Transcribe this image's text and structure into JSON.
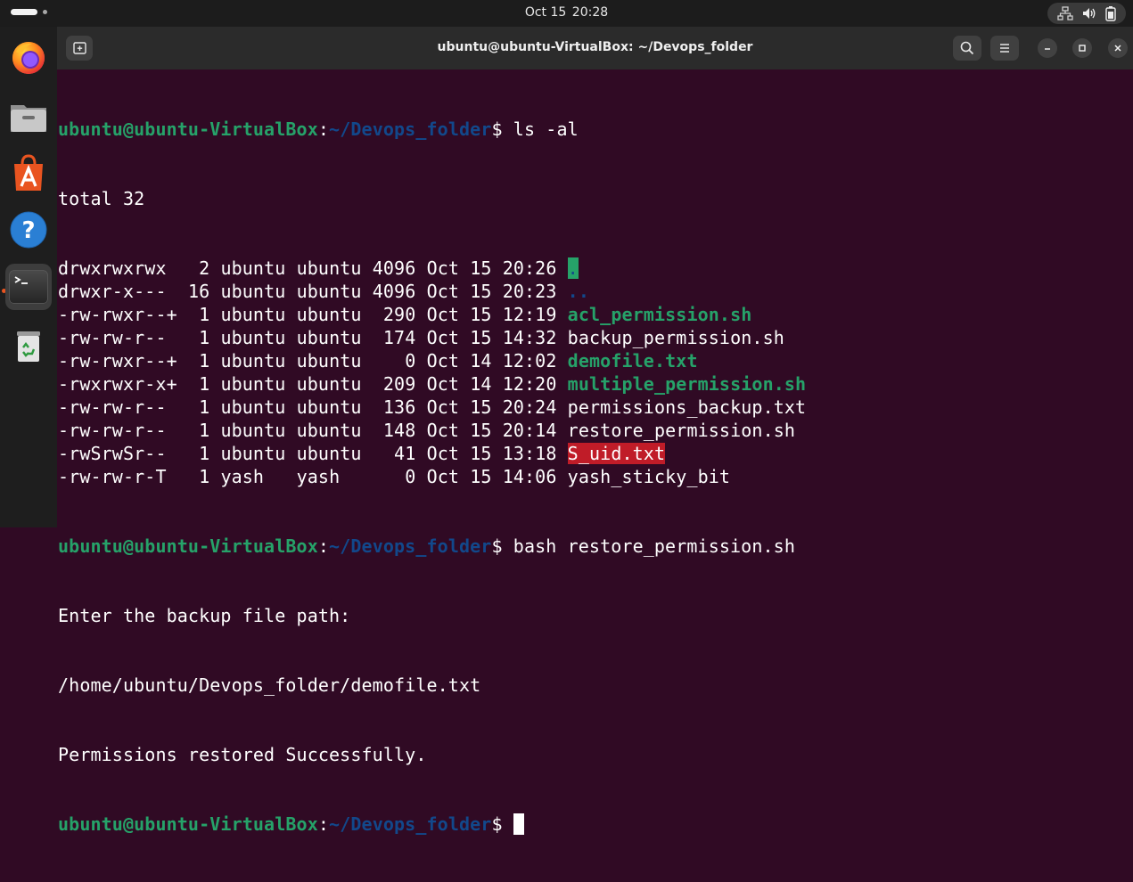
{
  "topbar": {
    "date": "Oct 15",
    "time": "20:28",
    "tray_icons": [
      "network-icon",
      "volume-icon",
      "battery-icon"
    ]
  },
  "dock": {
    "apps": [
      {
        "name": "firefox-icon",
        "label": "Firefox"
      },
      {
        "name": "files-icon",
        "label": "Files"
      },
      {
        "name": "app-center-icon",
        "label": "App Center"
      },
      {
        "name": "help-icon",
        "label": "Help"
      },
      {
        "name": "terminal-icon",
        "label": "Terminal",
        "active": true
      },
      {
        "name": "trash-icon",
        "label": "Trash"
      }
    ]
  },
  "window": {
    "title": "ubuntu@ubuntu-VirtualBox: ~/Devops_folder"
  },
  "terminal": {
    "prompt_user": "ubuntu@ubuntu-VirtualBox",
    "prompt_path": "~/Devops_folder",
    "cmd1": "ls -al",
    "total": "total 32",
    "listing": [
      {
        "perms": "drwxrwxrwx ",
        "links": " 2",
        "owner": "ubuntu",
        "group": "ubuntu",
        "size": "4096",
        "date": "Oct 15 20:26",
        "name": ".",
        "style": "hl-green"
      },
      {
        "perms": "drwxr-x--- ",
        "links": "16",
        "owner": "ubuntu",
        "group": "ubuntu",
        "size": "4096",
        "date": "Oct 15 20:23",
        "name": "..",
        "style": "blue"
      },
      {
        "perms": "-rw-rwxr--+",
        "links": " 1",
        "owner": "ubuntu",
        "group": "ubuntu",
        "size": " 290",
        "date": "Oct 15 12:19",
        "name": "acl_permission.sh",
        "style": "bgreen"
      },
      {
        "perms": "-rw-rw-r-- ",
        "links": " 1",
        "owner": "ubuntu",
        "group": "ubuntu",
        "size": " 174",
        "date": "Oct 15 14:32",
        "name": "backup_permission.sh",
        "style": "plain"
      },
      {
        "perms": "-rw-rwxr--+",
        "links": " 1",
        "owner": "ubuntu",
        "group": "ubuntu",
        "size": "   0",
        "date": "Oct 14 12:02",
        "name": "demofile.txt",
        "style": "bgreen"
      },
      {
        "perms": "-rwxrwxr-x+",
        "links": " 1",
        "owner": "ubuntu",
        "group": "ubuntu",
        "size": " 209",
        "date": "Oct 14 12:20",
        "name": "multiple_permission.sh",
        "style": "bgreen"
      },
      {
        "perms": "-rw-rw-r-- ",
        "links": " 1",
        "owner": "ubuntu",
        "group": "ubuntu",
        "size": " 136",
        "date": "Oct 15 20:24",
        "name": "permissions_backup.txt",
        "style": "plain"
      },
      {
        "perms": "-rw-rw-r-- ",
        "links": " 1",
        "owner": "ubuntu",
        "group": "ubuntu",
        "size": " 148",
        "date": "Oct 15 20:14",
        "name": "restore_permission.sh",
        "style": "plain"
      },
      {
        "perms": "-rwSrwSr-- ",
        "links": " 1",
        "owner": "ubuntu",
        "group": "ubuntu",
        "size": "  41",
        "date": "Oct 15 13:18",
        "name": "S_uid.txt",
        "style": "hl-red"
      },
      {
        "perms": "-rw-rw-r-T ",
        "links": " 1",
        "owner": "yash  ",
        "group": "yash  ",
        "size": "   0",
        "date": "Oct 15 14:06",
        "name": "yash_sticky_bit",
        "style": "plain"
      }
    ],
    "cmd2": "bash restore_permission.sh",
    "out1": "Enter the backup file path:",
    "out2": "/home/ubuntu/Devops_folder/demofile.txt",
    "out3": "Permissions restored Successfully."
  }
}
